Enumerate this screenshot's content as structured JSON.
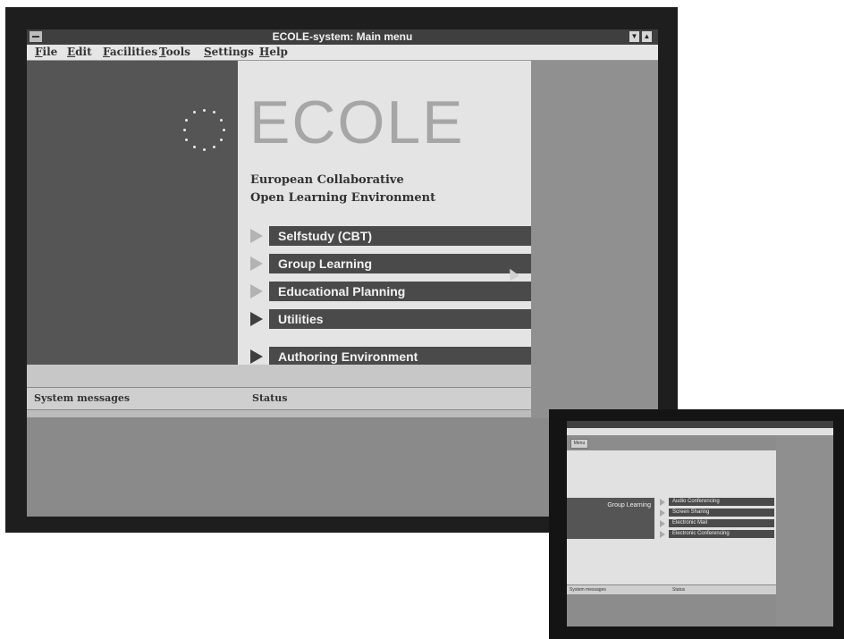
{
  "main_window": {
    "title": "ECOLE-system: Main menu",
    "menu": [
      {
        "first": "F",
        "rest": "ile"
      },
      {
        "first": "E",
        "rest": "dit"
      },
      {
        "first": "F",
        "rest": "acilities"
      },
      {
        "first": "T",
        "rest": "ools"
      },
      {
        "first": "S",
        "rest": "ettings"
      },
      {
        "first": "H",
        "rest": "elp"
      }
    ],
    "logo": "ECOLE",
    "subtitle_line1": "European Collaborative",
    "subtitle_line2": "Open Learning Environment",
    "main_menu": [
      {
        "label": "Selfstudy (CBT)"
      },
      {
        "label": "Group Learning"
      },
      {
        "label": "Educational Planning"
      },
      {
        "label": "Utilities"
      },
      {
        "label": "Authoring Environment"
      }
    ],
    "status": {
      "system_messages_label": "System messages",
      "status_label": "Status"
    }
  },
  "inset_window": {
    "menu_button": "Menu",
    "left_label": "Group Learning",
    "submenu": [
      {
        "label": "Audio Conferencing"
      },
      {
        "label": "Screen Sharing"
      },
      {
        "label": "Electronic Mail"
      },
      {
        "label": "Electronic Conferencing"
      }
    ],
    "status": {
      "system_messages_label": "System messages",
      "status_label": "Status"
    }
  },
  "colors": {
    "titlebar": "#3f3f3f",
    "menu_button": "#4a4a4a",
    "logo": "#a6a6a6",
    "panel": "#555555"
  },
  "icons": [
    "system-menu-icon",
    "minimize-icon",
    "maximize-icon",
    "eu-stars-icon",
    "arrow-icon",
    "mouse-cursor-icon"
  ]
}
